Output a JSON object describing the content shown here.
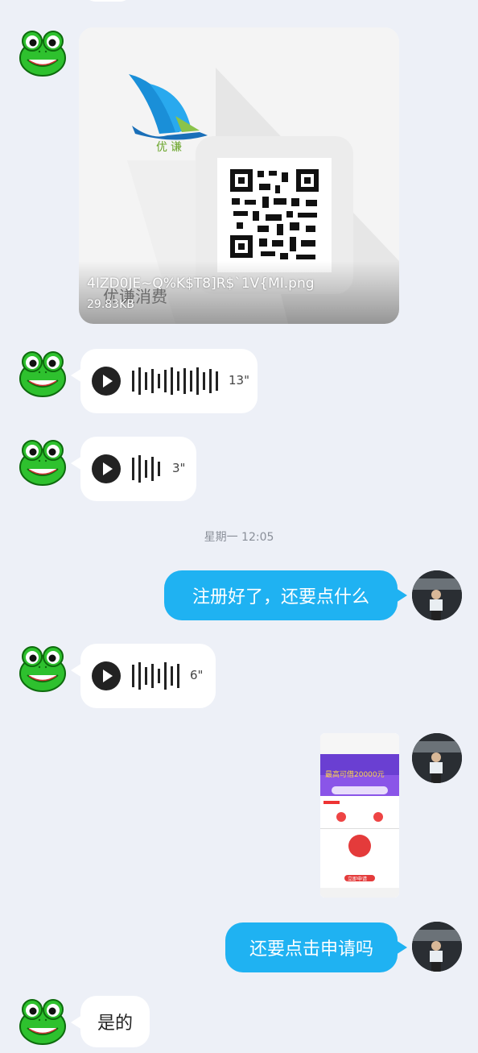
{
  "messages": {
    "file": {
      "brand_logo_text": "优谦",
      "brand_text": "优谦消费",
      "file_name": "4IZD0JE~Q%K$T8]R$`1V{MI.png",
      "file_size": "29.83KB"
    },
    "voice1": {
      "duration": "13\""
    },
    "voice2": {
      "duration": "3\""
    },
    "timestamp": "星期一 12:05",
    "out1": {
      "text": "注册好了，还要点什么"
    },
    "voice3": {
      "duration": "6\""
    },
    "image_thumb": {
      "amount_text": "最高可借20000元",
      "apply_text": "立即申请"
    },
    "out2": {
      "text": "还要点击申请吗"
    },
    "in_text": {
      "text": "是的"
    }
  },
  "icons": {
    "play": "play-icon",
    "waveform": "waveform-icon",
    "frog": "frog-avatar"
  },
  "colors": {
    "background": "#edf0f7",
    "outgoing_bubble": "#1fb2f2",
    "incoming_bubble": "#ffffff"
  }
}
